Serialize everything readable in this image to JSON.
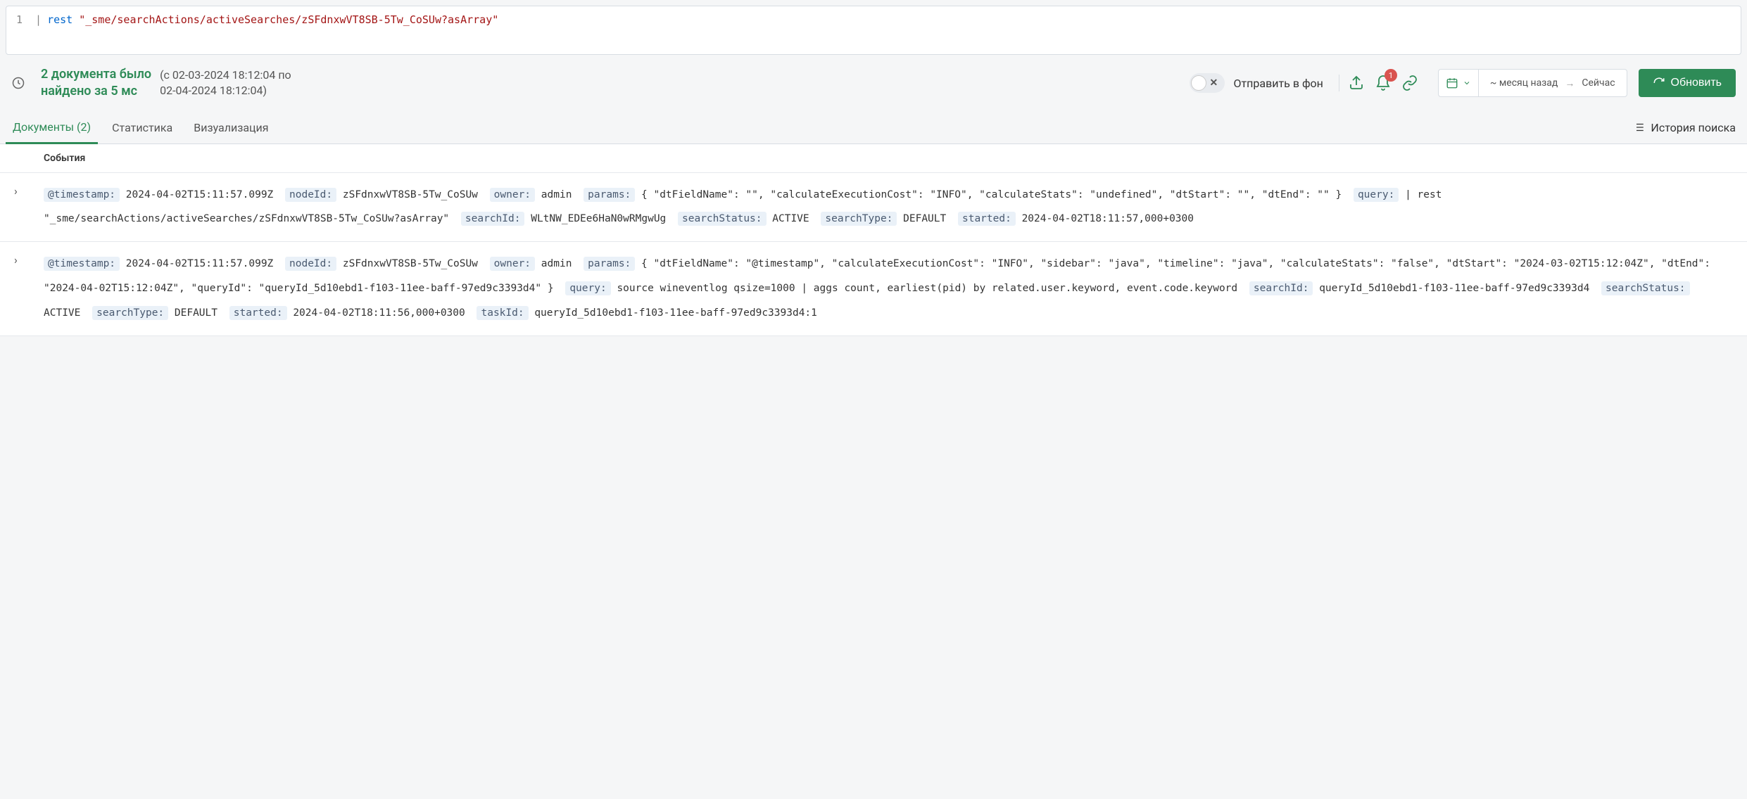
{
  "editor": {
    "line_number": "1",
    "pipe": "|",
    "keyword": "rest",
    "string": "\"_sme/searchActions/activeSearches/zSFdnxwVT8SB-5Tw_CoSUw?asArray\""
  },
  "toolbar": {
    "doc_count_line1": "2 документа было",
    "doc_count_line2": "найдено за 5 мс",
    "date_from": "(с 02-03-2024 18:12:04 по",
    "date_to": "02-04-2024 18:12:04)",
    "toggle_label": "Отправить в фон",
    "badge": "1",
    "date_range_prefix": "~ месяц назад",
    "date_range_arrow": "→",
    "date_range_suffix": "Сейчас",
    "refresh": "Обновить"
  },
  "tabs": {
    "documents": "Документы (2)",
    "stats": "Статистика",
    "viz": "Визуализация",
    "history": "История поиска"
  },
  "events": {
    "header": "События",
    "rows": [
      {
        "fields": [
          {
            "k": "@timestamp:",
            "v": "2024-04-02T15:11:57.099Z"
          },
          {
            "k": "nodeId:",
            "v": "zSFdnxwVT8SB-5Tw_CoSUw"
          },
          {
            "k": "owner:",
            "v": "admin"
          },
          {
            "k": "params:",
            "v": "{ \"dtFieldName\": \"\", \"calculateExecutionCost\": \"INFO\", \"calculateStats\": \"undefined\", \"dtStart\": \"\", \"dtEnd\": \"\" }"
          },
          {
            "k": "query:",
            "v": "| rest \"_sme/searchActions/activeSearches/zSFdnxwVT8SB-5Tw_CoSUw?asArray\""
          },
          {
            "k": "searchId:",
            "v": "WLtNW_EDEe6HaN0wRMgwUg"
          },
          {
            "k": "searchStatus:",
            "v": "ACTIVE"
          },
          {
            "k": "searchType:",
            "v": "DEFAULT"
          },
          {
            "k": "started:",
            "v": "2024-04-02T18:11:57,000+0300"
          }
        ]
      },
      {
        "fields": [
          {
            "k": "@timestamp:",
            "v": "2024-04-02T15:11:57.099Z"
          },
          {
            "k": "nodeId:",
            "v": "zSFdnxwVT8SB-5Tw_CoSUw"
          },
          {
            "k": "owner:",
            "v": "admin"
          },
          {
            "k": "params:",
            "v": "{ \"dtFieldName\": \"@timestamp\", \"calculateExecutionCost\": \"INFO\", \"sidebar\": \"java\", \"timeline\": \"java\", \"calculateStats\": \"false\", \"dtStart\": \"2024-03-02T15:12:04Z\", \"dtEnd\": \"2024-04-02T15:12:04Z\", \"queryId\": \"queryId_5d10ebd1-f103-11ee-baff-97ed9c3393d4\" }"
          },
          {
            "k": "query:",
            "v": "source wineventlog qsize=1000 | aggs count, earliest(pid) by related.user.keyword, event.code.keyword"
          },
          {
            "k": "searchId:",
            "v": "queryId_5d10ebd1-f103-11ee-baff-97ed9c3393d4"
          },
          {
            "k": "searchStatus:",
            "v": "ACTIVE"
          },
          {
            "k": "searchType:",
            "v": "DEFAULT"
          },
          {
            "k": "started:",
            "v": "2024-04-02T18:11:56,000+0300"
          },
          {
            "k": "taskId:",
            "v": "queryId_5d10ebd1-f103-11ee-baff-97ed9c3393d4:1"
          }
        ]
      }
    ]
  }
}
